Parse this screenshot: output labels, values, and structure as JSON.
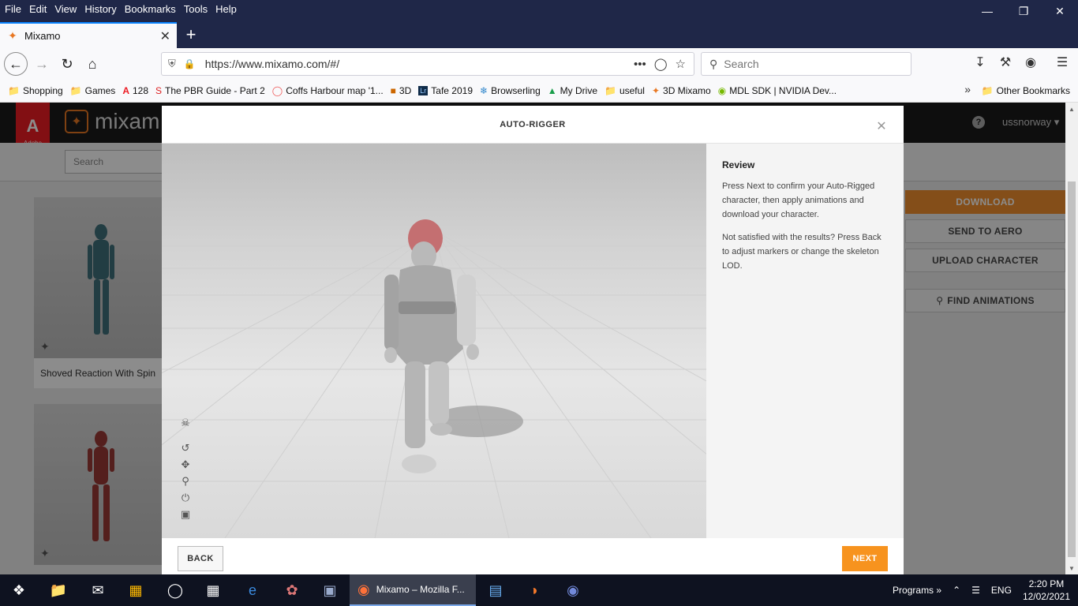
{
  "menubar": [
    "File",
    "Edit",
    "View",
    "History",
    "Bookmarks",
    "Tools",
    "Help"
  ],
  "tab": {
    "title": "Mixamo"
  },
  "url": "https://www.mixamo.com/#/",
  "search_placeholder": "Search",
  "bookmarks": [
    {
      "icon": "folder-icon",
      "label": "Shopping"
    },
    {
      "icon": "folder-icon",
      "label": "Games"
    },
    {
      "icon": "adobe-icon",
      "label": "128"
    },
    {
      "icon": "pbr-icon",
      "label": "The PBR Guide - Part 2"
    },
    {
      "icon": "map-icon",
      "label": "Coffs Harbour map '1..."
    },
    {
      "icon": "cube-icon",
      "label": "3D"
    },
    {
      "icon": "lightroom-icon",
      "label": "Tafe 2019"
    },
    {
      "icon": "browser-icon",
      "label": "Browserling"
    },
    {
      "icon": "drive-icon",
      "label": "My Drive"
    },
    {
      "icon": "folder-icon",
      "label": "useful"
    },
    {
      "icon": "mixamo-icon",
      "label": "3D Mixamo"
    },
    {
      "icon": "nvidia-icon",
      "label": "MDL SDK | NVIDIA Dev..."
    }
  ],
  "other_bookmarks": "Other Bookmarks",
  "mixamo": {
    "brand": "mixam",
    "adobe": "Adobe",
    "username": "ussnorway",
    "search_placeholder": "Search",
    "cards": [
      "Shoved Reaction With Spin"
    ],
    "side_buttons": [
      "DOWNLOAD",
      "SEND TO AERO",
      "UPLOAD CHARACTER",
      "FIND ANIMATIONS"
    ]
  },
  "modal": {
    "title": "AUTO-RIGGER",
    "review_title": "Review",
    "review_p1": "Press Next to confirm your Auto-Rigged character, then apply animations and download your character.",
    "review_p2": "Not satisfied with the results? Press Back to adjust markers or change the skeleton LOD.",
    "back": "BACK",
    "next": "NEXT"
  },
  "taskbar": {
    "firefox_label": "Mixamo – Mozilla F...",
    "programs": "Programs",
    "lang": "ENG",
    "time": "2:20 PM",
    "date": "12/02/2021"
  },
  "colors": {
    "accent": "#f7931e",
    "chrome": "#1f2748",
    "adobe_red": "#ed1c24"
  }
}
